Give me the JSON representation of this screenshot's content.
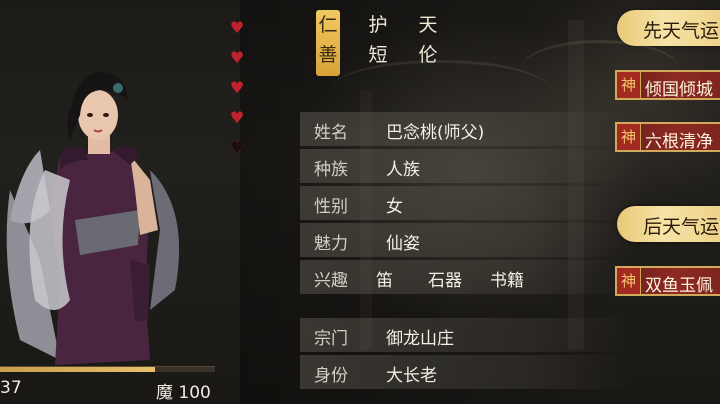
{
  "traits": [
    "仁善",
    "护短",
    "天伦"
  ],
  "hearts": {
    "filled": 4,
    "total": 5
  },
  "info_rows": [
    {
      "label": "姓名",
      "value": "巴念桃(师父)"
    },
    {
      "label": "种族",
      "value": "人族"
    },
    {
      "label": "性别",
      "value": "女"
    },
    {
      "label": "魅力",
      "value": "仙姿"
    }
  ],
  "hobbies": {
    "label": "兴趣",
    "items": [
      "笛",
      "石器",
      "书籍"
    ]
  },
  "sect_rows": [
    {
      "label": "宗门",
      "value": "御龙山庄"
    },
    {
      "label": "身份",
      "value": "大长老"
    }
  ],
  "stats": {
    "left_value": "37",
    "right_label": "魔 100",
    "bar_fill_fraction": 0.72
  },
  "innate": {
    "header": "先天气运",
    "talents": [
      "倾国倾城",
      "六根清净"
    ]
  },
  "acquired": {
    "header": "后天气运",
    "talents": [
      "双鱼玉佩"
    ]
  },
  "talent_seal_glyph": "神",
  "colors": {
    "heart": "#c0232d",
    "gold": "#e8c06a",
    "talent_red": "#8c2a22"
  }
}
